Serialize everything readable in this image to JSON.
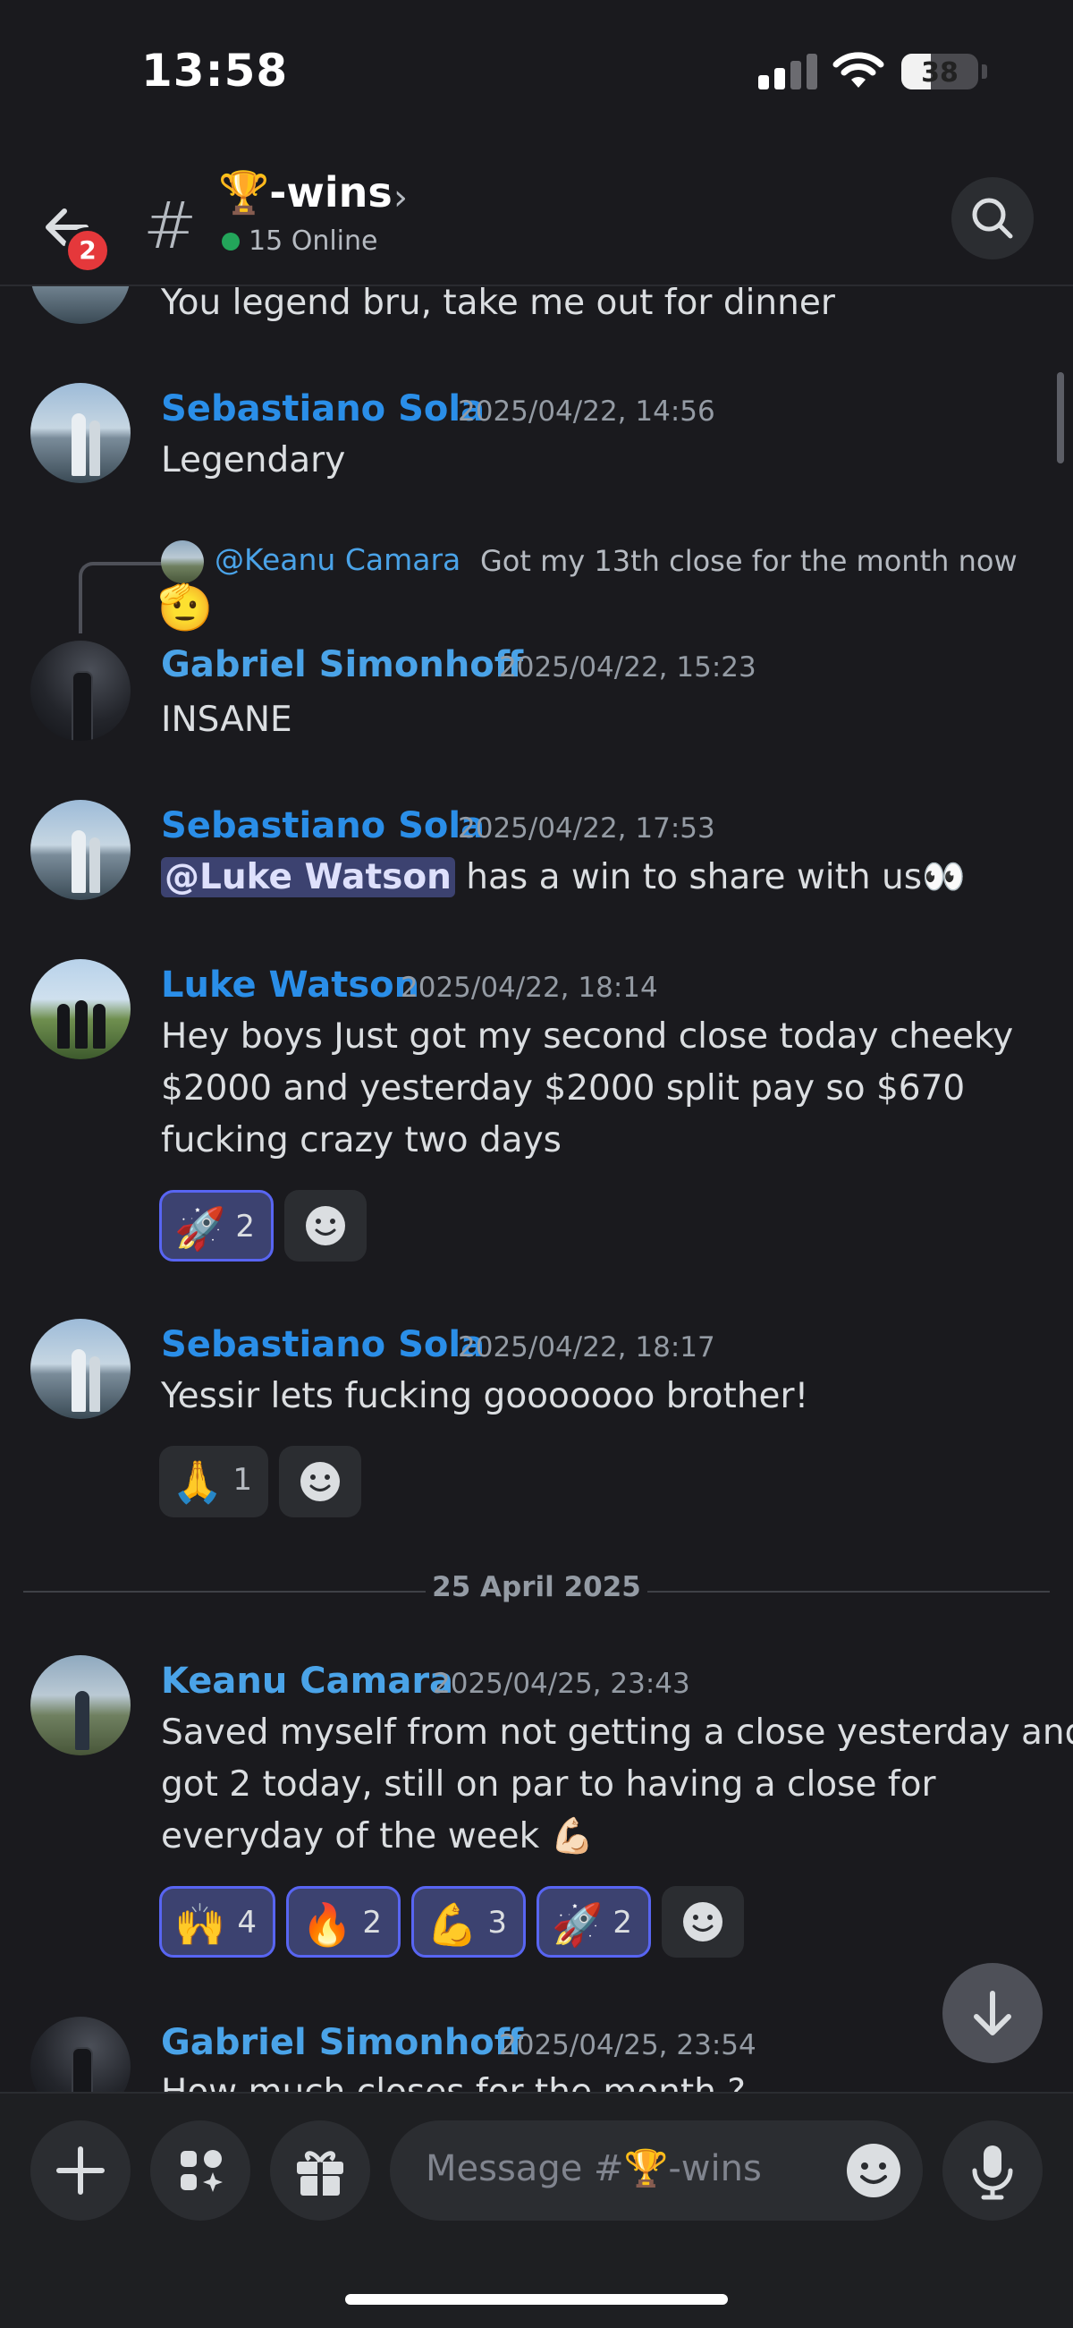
{
  "status_bar": {
    "time": "13:58",
    "battery": "38"
  },
  "header": {
    "back_badge": "2",
    "channel_hash": "#",
    "channel_name": "🏆-wins",
    "chevron": "›",
    "online": "15 Online"
  },
  "messages": [
    {
      "text": "You legend bru,  take me out for dinner"
    },
    {
      "author": "Sebastiano Sola",
      "timestamp": "2025/04/22, 14:56",
      "text": "Legendary"
    },
    {
      "reply_to": {
        "mention": "@Keanu Camara",
        "text": "Got my 13th close for the month now",
        "emoji": "🫡"
      },
      "author": "Gabriel Simonhoff",
      "timestamp": "2025/04/22, 15:23",
      "text": "INSANE"
    },
    {
      "author": "Sebastiano Sola",
      "timestamp": "2025/04/22, 17:53",
      "mention": "@Luke Watson",
      "text": " has a win to share with us👀"
    },
    {
      "author": "Luke Watson",
      "timestamp": "2025/04/22, 18:14",
      "lines": [
        "Hey boys Just got my second close today cheeky",
        "$2000 and yesterday $2000 split pay so $670",
        "fucking crazy two days"
      ],
      "reactions": [
        {
          "emoji": "🚀",
          "count": "2",
          "active": true
        }
      ]
    },
    {
      "author": "Sebastiano Sola",
      "timestamp": "2025/04/22, 18:17",
      "text": "Yessir lets fucking gooooooo brother!",
      "reactions": [
        {
          "emoji": "🙏",
          "count": "1",
          "active": false
        }
      ]
    },
    {
      "author": "Keanu Camara",
      "timestamp": "2025/04/25, 23:43",
      "lines": [
        "Saved myself from not getting a close yesterday and",
        "got 2 today, still on par to having a close for",
        "everyday of the week 💪🏻"
      ],
      "reactions": [
        {
          "emoji": "🙌",
          "count": "4",
          "active": true
        },
        {
          "emoji": "🔥",
          "count": "2",
          "active": true
        },
        {
          "emoji": "💪",
          "count": "3",
          "active": true
        },
        {
          "emoji": "🚀",
          "count": "2",
          "active": true
        }
      ]
    },
    {
      "author": "Gabriel Simonhoff",
      "timestamp": "2025/04/25, 23:54",
      "text": "How much closes for the month ?"
    }
  ],
  "date_divider": "25 April 2025",
  "composer": {
    "placeholder": "Message #🏆-wins"
  },
  "colors": {
    "author_blue": "#2a8ee8",
    "accent": "#5865f2",
    "online_green": "#23a55a",
    "badge_red": "#e5383b"
  },
  "icons": [
    "back-arrow-icon",
    "search-icon",
    "add-reaction-icon",
    "jump-to-present-icon",
    "plus-icon",
    "apps-icon",
    "gift-icon",
    "emoji-icon",
    "microphone-icon"
  ]
}
